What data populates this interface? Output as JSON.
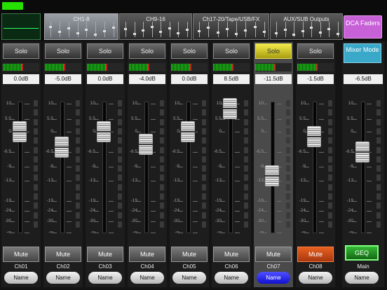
{
  "banks": [
    {
      "label": "CH1-8",
      "active": true
    },
    {
      "label": "CH9-16",
      "active": false
    },
    {
      "label": "Ch17-20/Tape/USB/FX",
      "active": false
    },
    {
      "label": "AUX/SUB Outputs",
      "active": false
    }
  ],
  "dca_button": "DCA Faders",
  "mixer_mode": "Mixer Mode",
  "solo_label": "Solo",
  "mute_label": "Mute",
  "name_button": "Name",
  "scale": [
    "10",
    "5.5",
    "0",
    "-6.5",
    "-9",
    "-13",
    "-19",
    "-24",
    "-30",
    "-∞"
  ],
  "channels": [
    {
      "id": "Ch01",
      "gain": "0.0dB",
      "fader_db": 0.0,
      "meter": 0.55,
      "solo_on": false,
      "mute_on": false,
      "selected": false
    },
    {
      "id": "Ch02",
      "gain": "-5.0dB",
      "fader_db": -5.0,
      "meter": 0.55,
      "solo_on": false,
      "mute_on": false,
      "selected": false
    },
    {
      "id": "Ch03",
      "gain": "0.0dB",
      "fader_db": 0.0,
      "meter": 0.55,
      "solo_on": false,
      "mute_on": false,
      "selected": false
    },
    {
      "id": "Ch04",
      "gain": "-4.0dB",
      "fader_db": -4.0,
      "meter": 0.55,
      "solo_on": false,
      "mute_on": false,
      "selected": false
    },
    {
      "id": "Ch05",
      "gain": "0.0dB",
      "fader_db": 0.0,
      "meter": 0.55,
      "solo_on": false,
      "mute_on": false,
      "selected": false
    },
    {
      "id": "Ch06",
      "gain": "8.5dB",
      "fader_db": 8.5,
      "meter": 0.55,
      "solo_on": false,
      "mute_on": false,
      "selected": false
    },
    {
      "id": "Ch07",
      "gain": "-11.5dB",
      "fader_db": -11.5,
      "meter": 0.55,
      "solo_on": true,
      "mute_on": false,
      "selected": true
    },
    {
      "id": "Ch08",
      "gain": "-1.5dB",
      "fader_db": -1.5,
      "meter": 0.55,
      "solo_on": false,
      "mute_on": true,
      "selected": false
    }
  ],
  "master": {
    "id": "Main",
    "gain": "-6.5dB",
    "fader_db": -6.5,
    "geq_label": "GEQ"
  },
  "colors": {
    "solo_active": "#e8e040",
    "mute_active": "#e05a20",
    "name_selected": "#2020ff",
    "dca": "#c860d8",
    "mixer_mode": "#3aa8c8",
    "geq": "#26a626"
  }
}
